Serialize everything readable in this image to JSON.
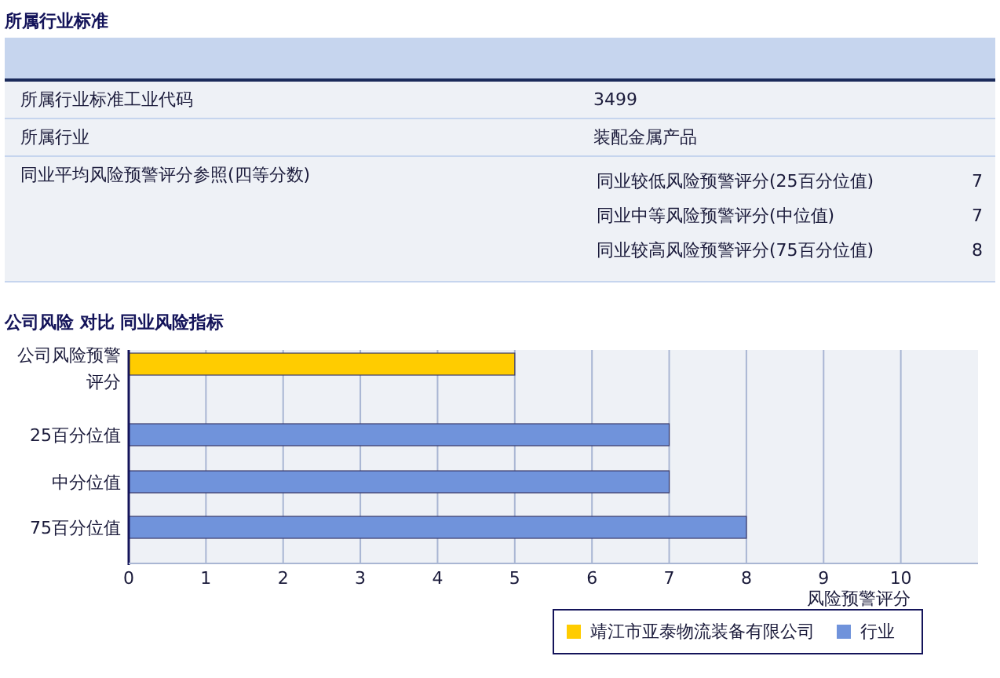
{
  "section_title": "所属行业标准",
  "table": {
    "rows": [
      {
        "label": "所属行业标准工业代码",
        "value": "3499"
      },
      {
        "label": "所属行业",
        "value": "装配金属产品"
      },
      {
        "label": "同业平均风险预警评分参照(四等分数)",
        "sub_rows": [
          {
            "label": "同业较低风险预警评分(25百分位值)",
            "value": "7"
          },
          {
            "label": "同业中等风险预警评分(中位值)",
            "value": "7"
          },
          {
            "label": "同业较高风险预警评分(75百分位值)",
            "value": "8"
          }
        ]
      }
    ]
  },
  "chart_title": "公司风险 对比 同业风险指标",
  "chart_data": {
    "type": "bar",
    "orientation": "horizontal",
    "stacked": true,
    "grid": true,
    "legend": "bottom right",
    "xlabel": "风险预警评分",
    "categories": [
      "公司风险预警评分",
      "25百分位值",
      "中分位值",
      "75百分位值"
    ],
    "series": [
      {
        "name": "靖江市亚泰物流装备有限公司",
        "color": "#ffcc00",
        "values": [
          5,
          null,
          null,
          null
        ]
      },
      {
        "name": "行业",
        "color": "#7093db",
        "values": [
          null,
          7,
          7,
          8
        ]
      }
    ],
    "xlim": [
      0,
      11
    ],
    "xticks": [
      0,
      1,
      2,
      3,
      4,
      5,
      6,
      7,
      8,
      9,
      10
    ]
  }
}
